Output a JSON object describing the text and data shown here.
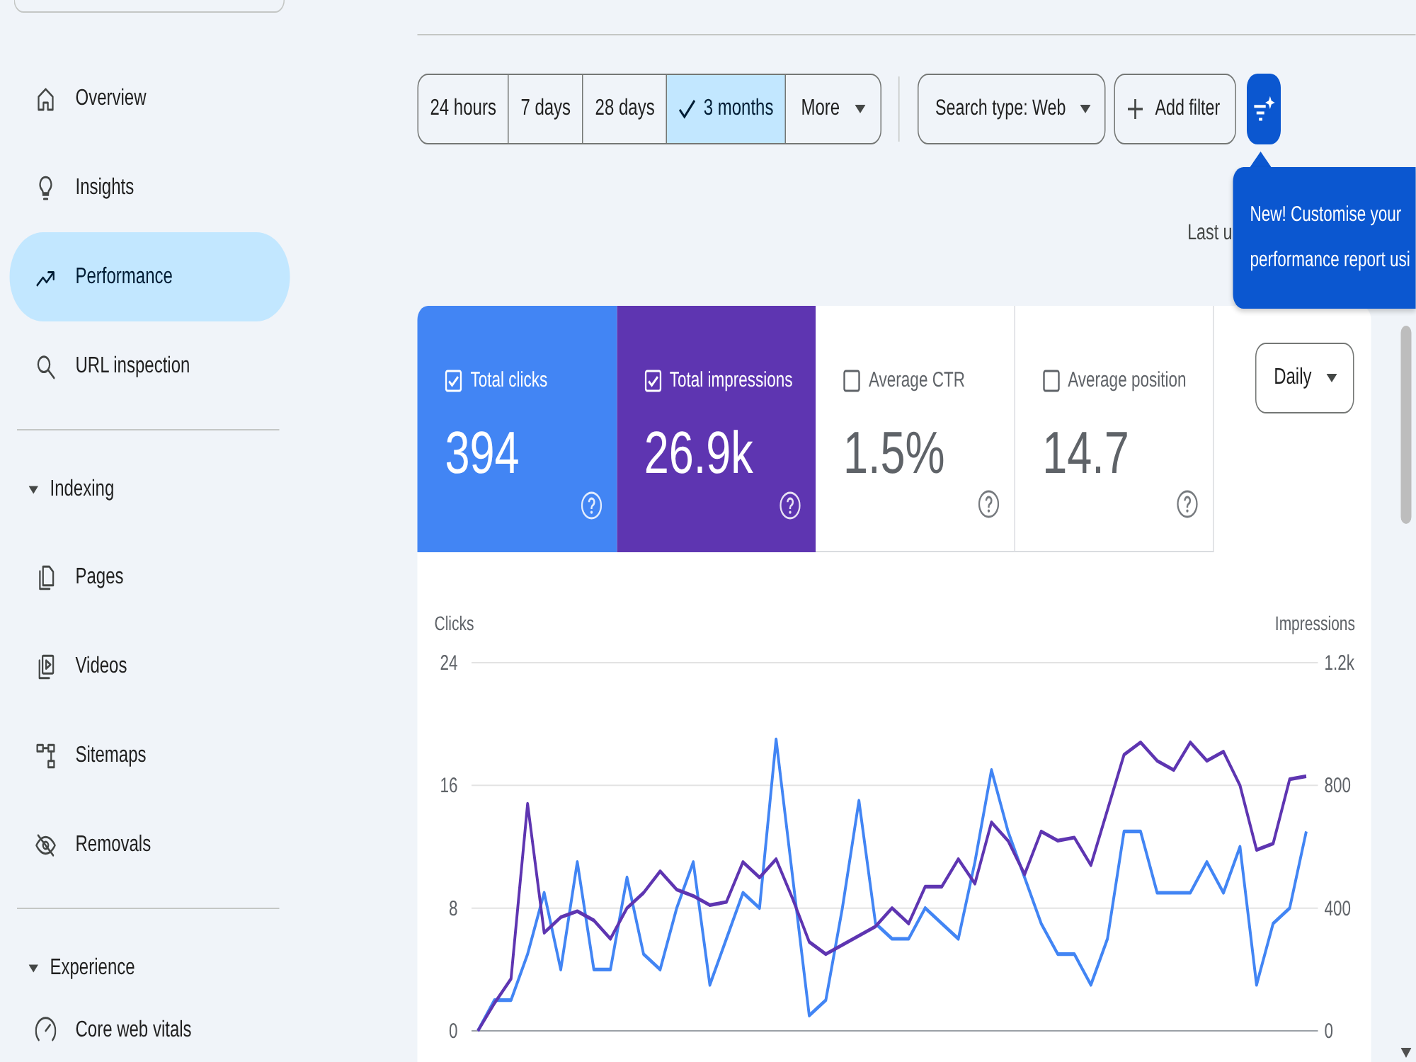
{
  "sidebar": {
    "sections": [
      {
        "items": [
          {
            "label": "Overview",
            "selected": false
          },
          {
            "label": "Insights",
            "selected": false
          },
          {
            "label": "Performance",
            "selected": true
          },
          {
            "label": "URL inspection",
            "selected": false
          }
        ]
      },
      {
        "title": "Indexing",
        "expanded": true,
        "items": [
          {
            "label": "Pages",
            "selected": false
          },
          {
            "label": "Videos",
            "selected": false
          },
          {
            "label": "Sitemaps",
            "selected": false
          },
          {
            "label": "Removals",
            "selected": false
          }
        ]
      },
      {
        "title": "Experience",
        "expanded": true,
        "items": [
          {
            "label": "Core web vitals",
            "selected": false
          }
        ]
      }
    ]
  },
  "toolbar": {
    "date_ranges": [
      {
        "label": "24 hours",
        "selected": false
      },
      {
        "label": "7 days",
        "selected": false
      },
      {
        "label": "28 days",
        "selected": false
      },
      {
        "label": "3 months",
        "selected": true
      }
    ],
    "more": {
      "label": "More"
    },
    "filters": [
      {
        "kind": "dropdown",
        "label": "Search type: Web"
      },
      {
        "kind": "add",
        "label": "Add filter"
      }
    ]
  },
  "last_updated": "Last u",
  "tooltip": {
    "text": "New! Customise your performance report usi"
  },
  "metrics": [
    {
      "label": "Total clicks",
      "value": "394",
      "checked": true,
      "color": "#4285f4"
    },
    {
      "label": "Total impressions",
      "value": "26.9k",
      "checked": true,
      "color": "#5e35b1"
    },
    {
      "label": "Average CTR",
      "value": "1.5%",
      "checked": false
    },
    {
      "label": "Average position",
      "value": "14.7",
      "checked": false
    }
  ],
  "granularity": {
    "label": "Daily"
  },
  "chart": {
    "chart_data": {
      "type": "line",
      "ylabel": "Clicks",
      "y2label": "Impressions",
      "ylim": [
        0,
        24
      ],
      "yticks": [
        0,
        8,
        16,
        24
      ],
      "y2lim": [
        0,
        1200
      ],
      "y2ticks": [
        {
          "value": 0,
          "label": "0"
        },
        {
          "value": 400,
          "label": "400"
        },
        {
          "value": 800,
          "label": "800"
        },
        {
          "value": 1200,
          "label": "1.2k"
        }
      ],
      "series": [
        {
          "color": "#4285f4",
          "values": [
            0,
            2,
            2,
            5,
            9,
            4,
            11,
            4,
            4,
            10,
            5,
            4,
            8,
            11,
            3,
            6,
            9,
            8,
            19,
            10,
            1,
            2,
            8,
            15,
            7,
            6,
            6,
            8,
            7,
            6,
            11,
            17,
            13,
            10,
            7,
            5,
            5,
            3,
            6,
            13,
            13,
            9,
            9,
            9,
            11,
            9,
            12,
            3,
            7,
            8,
            13
          ]
        },
        {
          "color": "#5e35b1",
          "axis": "y2",
          "values": [
            0,
            90,
            170,
            740,
            320,
            370,
            390,
            360,
            300,
            400,
            450,
            520,
            460,
            440,
            410,
            420,
            550,
            500,
            560,
            430,
            290,
            250,
            280,
            310,
            340,
            400,
            350,
            470,
            470,
            560,
            480,
            680,
            620,
            510,
            650,
            620,
            630,
            540,
            720,
            900,
            940,
            880,
            850,
            940,
            880,
            910,
            800,
            590,
            610,
            820,
            830
          ]
        }
      ]
    }
  }
}
